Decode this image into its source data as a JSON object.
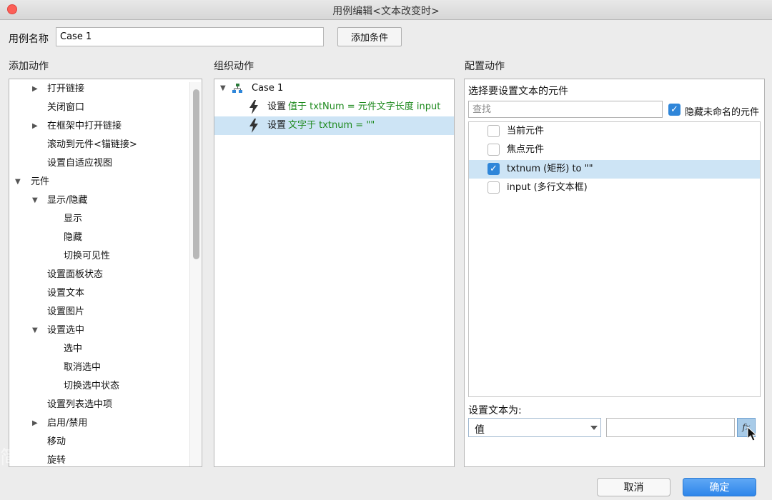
{
  "window": {
    "title": "用例编辑<文本改变时>"
  },
  "case_name": {
    "label": "用例名称",
    "value": "Case 1",
    "add_condition_label": "添加条件"
  },
  "add_actions": {
    "title": "添加动作",
    "items": [
      {
        "label": "打开链接",
        "caret": "▶"
      },
      {
        "label": "关闭窗口",
        "caret": ""
      },
      {
        "label": "在框架中打开链接",
        "caret": "▶"
      },
      {
        "label": "滚动到元件<锚链接>",
        "caret": ""
      },
      {
        "label": "设置自适应视图",
        "caret": ""
      },
      {
        "label": "元件",
        "caret": "▼"
      },
      {
        "label": "显示/隐藏",
        "caret": "▼"
      },
      {
        "label": "显示",
        "caret": ""
      },
      {
        "label": "隐藏",
        "caret": ""
      },
      {
        "label": "切换可见性",
        "caret": ""
      },
      {
        "label": "设置面板状态",
        "caret": ""
      },
      {
        "label": "设置文本",
        "caret": ""
      },
      {
        "label": "设置图片",
        "caret": ""
      },
      {
        "label": "设置选中",
        "caret": "▼"
      },
      {
        "label": "选中",
        "caret": ""
      },
      {
        "label": "取消选中",
        "caret": ""
      },
      {
        "label": "切换选中状态",
        "caret": ""
      },
      {
        "label": "设置列表选中项",
        "caret": ""
      },
      {
        "label": "启用/禁用",
        "caret": "▶"
      },
      {
        "label": "移动",
        "caret": ""
      },
      {
        "label": "旋转",
        "caret": ""
      }
    ]
  },
  "organize_actions": {
    "title": "组织动作",
    "case_label": "Case 1",
    "caret": "▼",
    "actions": [
      {
        "verb": "设置",
        "detail": "值于 txtNum = 元件文字长度 input"
      },
      {
        "verb": "设置",
        "detail": "文字于 txtnum = \"\""
      }
    ]
  },
  "configure_actions": {
    "title": "配置动作",
    "subtitle": "选择要设置文本的元件",
    "search_placeholder": "查找",
    "hide_unnamed_label": "隐藏未命名的元件",
    "check_mark": "✓",
    "widgets": [
      {
        "label": "当前元件"
      },
      {
        "label": "焦点元件"
      },
      {
        "label": "txtnum (矩形) to \"\""
      },
      {
        "label": "input (多行文本框)"
      }
    ],
    "set_text_label": "设置文本为:",
    "value_type": "值",
    "value_text": "",
    "fx_label": "fx"
  },
  "footer": {
    "cancel_label": "取消",
    "ok_label": "确定"
  },
  "watermark": "简单"
}
